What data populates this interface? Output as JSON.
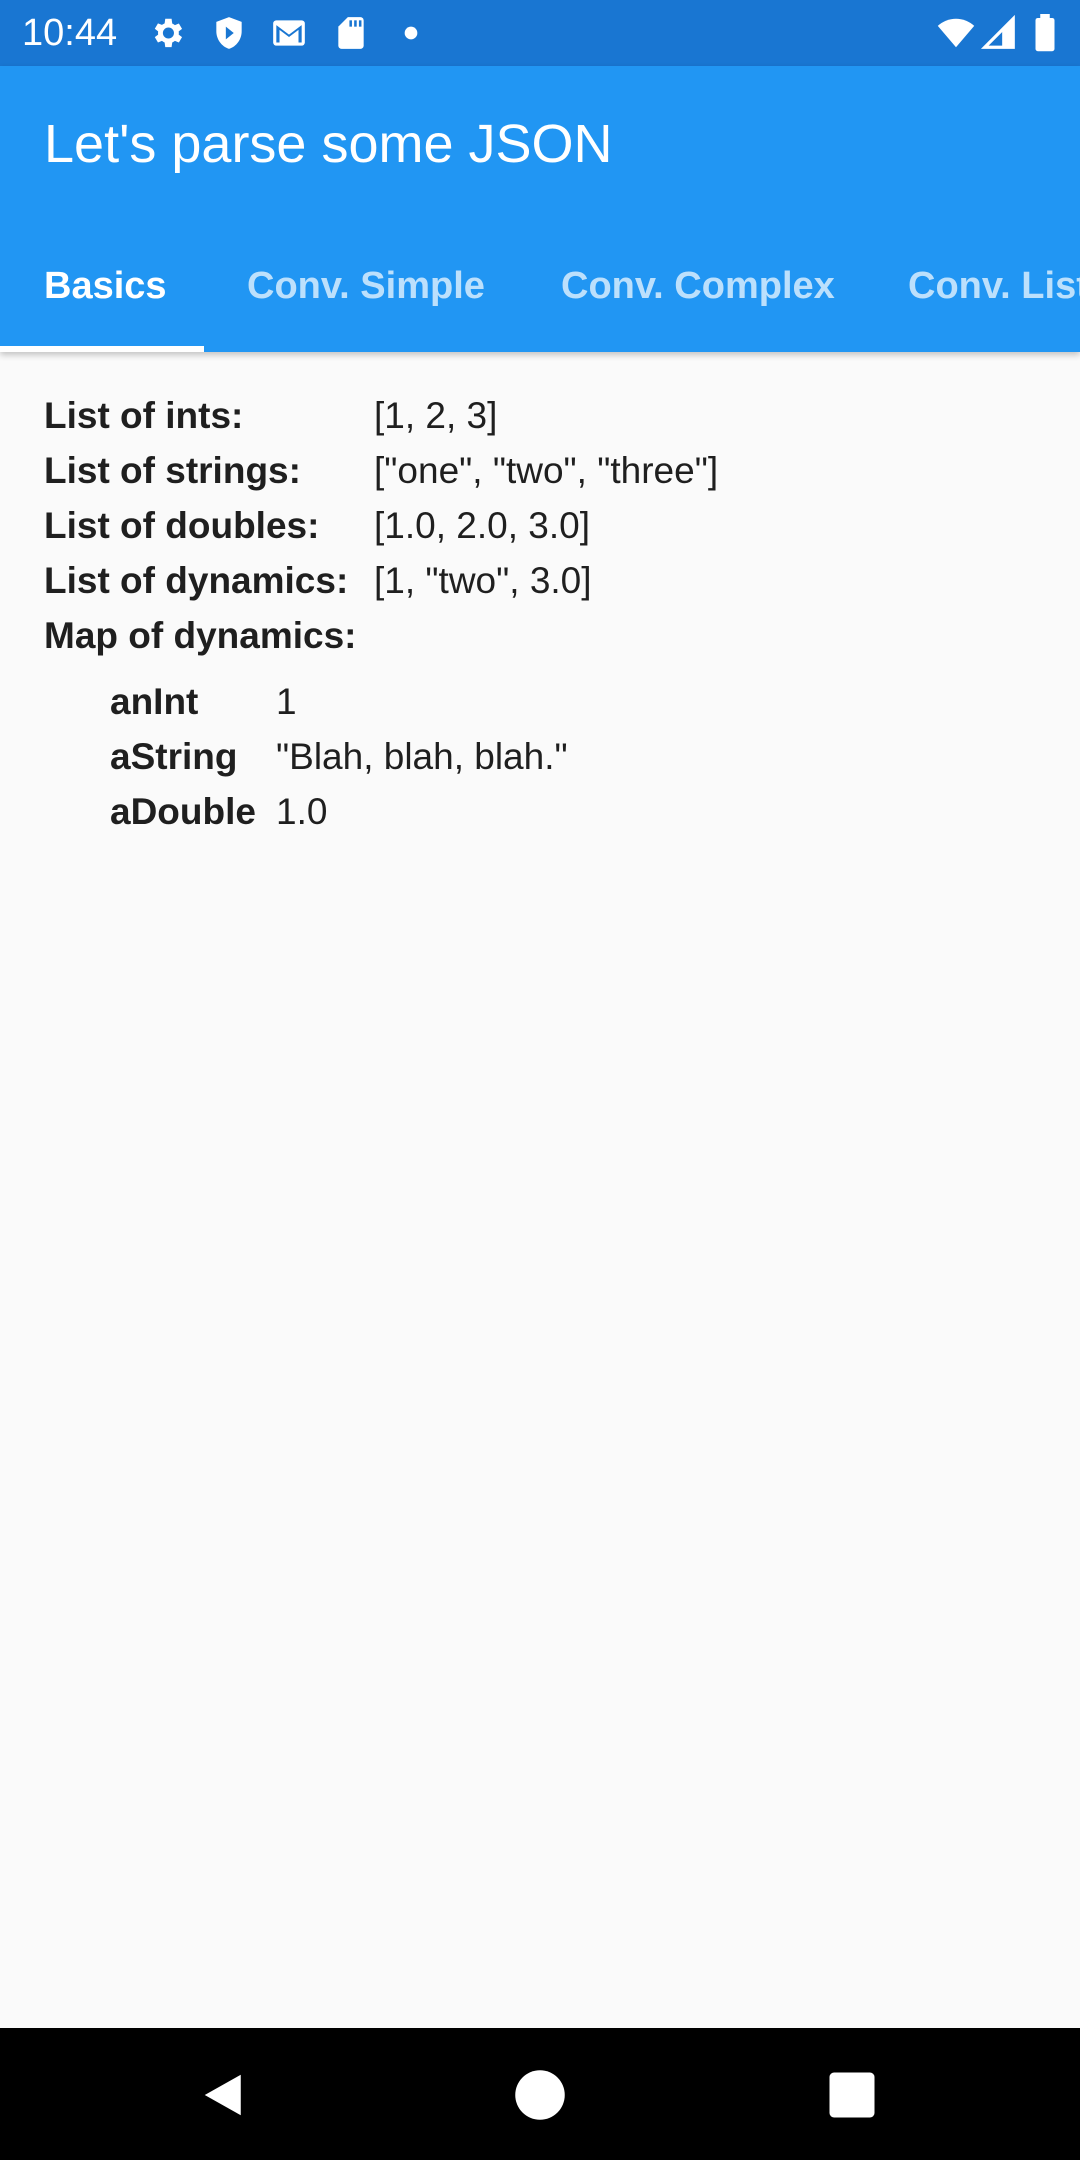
{
  "status_bar": {
    "time": "10:44",
    "left_icons": [
      "gear-icon",
      "shield-icon",
      "gmail-icon",
      "sd-card-icon",
      "dot-icon"
    ],
    "right_icons": [
      "wifi-icon",
      "cell-signal-icon",
      "battery-icon"
    ]
  },
  "app_bar": {
    "title": "Let's parse some JSON",
    "color": "#2196f3",
    "tabs": [
      {
        "label": "Basics",
        "active": true
      },
      {
        "label": "Conv. Simple",
        "active": false
      },
      {
        "label": "Conv. Complex",
        "active": false
      },
      {
        "label": "Conv. List",
        "active": false
      }
    ]
  },
  "content": {
    "rows": [
      {
        "key": "List of ints:",
        "value": "[1, 2, 3]"
      },
      {
        "key": "List of strings:",
        "value": "[\"one\", \"two\", \"three\"]"
      },
      {
        "key": "List of doubles:",
        "value": "[1.0, 2.0, 3.0]"
      },
      {
        "key": "List of dynamics:",
        "value": "[1, \"two\", 3.0]"
      },
      {
        "key": "Map of dynamics:",
        "value": ""
      }
    ],
    "map_entries": [
      {
        "key": "anInt",
        "value": "1"
      },
      {
        "key": "aString",
        "value": "\"Blah, blah, blah.\""
      },
      {
        "key": "aDouble",
        "value": "1.0"
      }
    ]
  },
  "nav_bar": {
    "buttons": [
      "back-icon",
      "home-icon",
      "recents-icon"
    ]
  }
}
